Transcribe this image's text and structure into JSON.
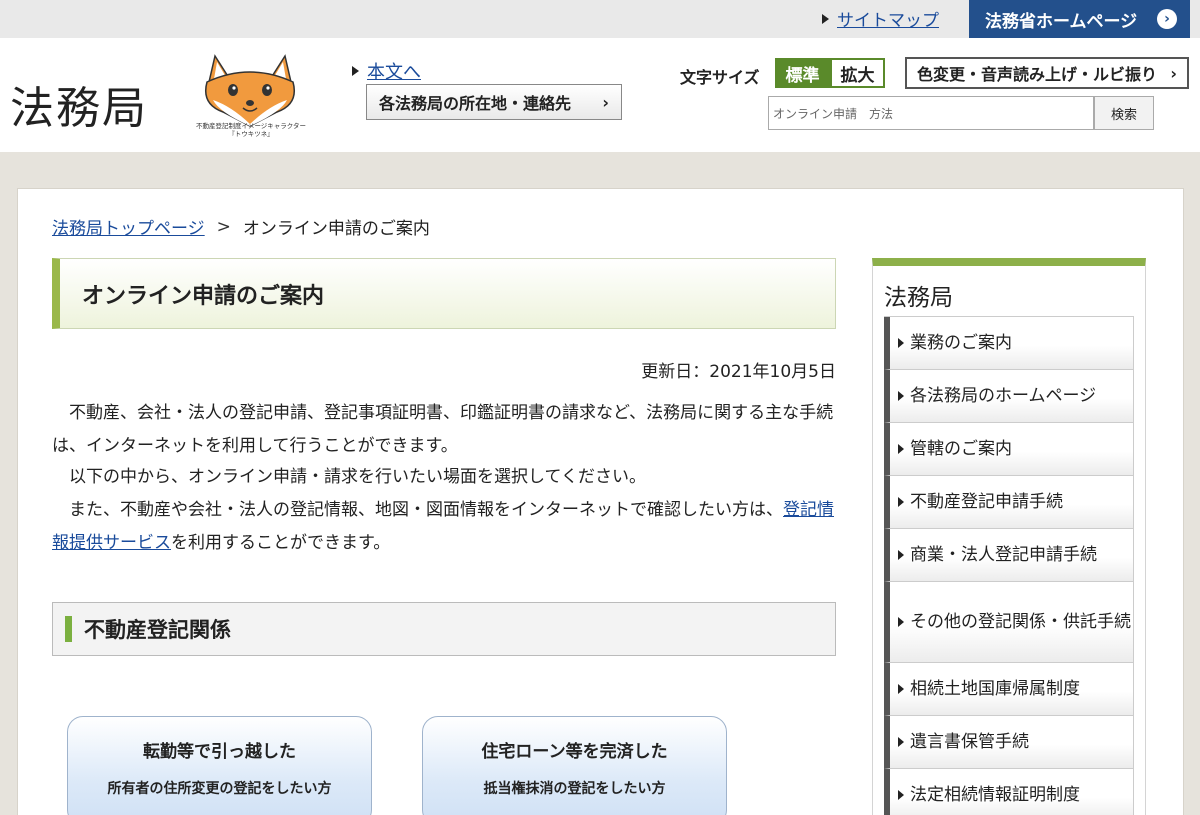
{
  "topbar": {
    "sitemap_label": "サイトマップ",
    "moj_home_label": "法務省ホームページ"
  },
  "header": {
    "logo_text": "法務局",
    "mascot_caption_line1": "不動産登記制度イメージキャラクター",
    "mascot_caption_line2": "『トウキツネ』",
    "skip_link": "本文へ",
    "offices_button": "各法務局の所在地・連絡先",
    "font_size_label": "文字サイズ",
    "font_size_standard": "標準",
    "font_size_large": "拡大",
    "accessibility_button": "色変更・音声読み上げ・ルビ振り",
    "search_value": "オンライン申請　方法",
    "search_button": "検索"
  },
  "breadcrumb": {
    "home": "法務局トップページ",
    "separator": ">",
    "current": "オンライン申請のご案内"
  },
  "main": {
    "title": "オンライン申請のご案内",
    "updated": "更新日：2021年10月5日",
    "para1": "　不動産、会社・法人の登記申請、登記事項証明書、印鑑証明書の請求など、法務局に関する主な手続は、インターネットを利用して行うことができます。",
    "para2": "　以下の中から、オンライン申請・請求を行いたい場面を選択してください。",
    "para3_before": "　また、不動産や会社・法人の登記情報、地図・図面情報をインターネットで確認したい方は、",
    "para3_link": "登記情報提供サービス",
    "para3_after": "を利用することができます。",
    "section_title": "不動産登記関係",
    "buttons": [
      {
        "line1": "転勤等で引っ越した",
        "line2": "所有者の住所変更の登記をしたい方"
      },
      {
        "line1": "住宅ローン等を完済した",
        "line2": "抵当権抹消の登記をしたい方"
      }
    ]
  },
  "sidebar": {
    "title": "法務局",
    "items": [
      {
        "label": "業務のご案内"
      },
      {
        "label": "各法務局のホームページ"
      },
      {
        "label": "管轄のご案内"
      },
      {
        "label": "不動産登記申請手続"
      },
      {
        "label": "商業・法人登記申請手続"
      },
      {
        "label": "その他の登記関係・供託手続"
      },
      {
        "label": "相続土地国庫帰属制度"
      },
      {
        "label": "遺言書保管手続"
      },
      {
        "label": "法定相続情報証明制度"
      }
    ]
  },
  "colors": {
    "accent_green": "#8db04a",
    "moj_blue": "#23508c",
    "link": "#1a4b9b"
  }
}
